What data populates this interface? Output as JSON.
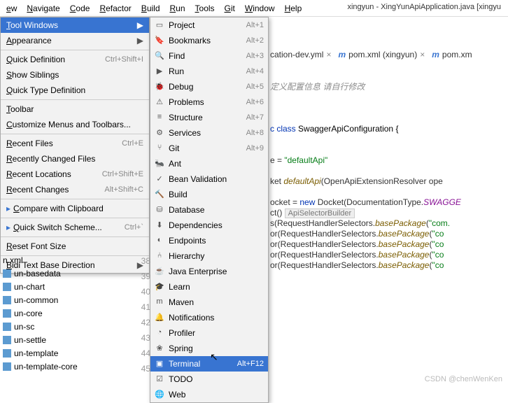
{
  "menubar": [
    "ew",
    "Navigate",
    "Code",
    "Refactor",
    "Build",
    "Run",
    "Tools",
    "Git",
    "Window",
    "Help"
  ],
  "title": "xingyun - XingYunApiApplication.java [xingyu",
  "dropdown1": [
    {
      "label": "Tool Windows",
      "sub": true,
      "sel": true
    },
    {
      "label": "Appearance",
      "sub": true
    },
    {
      "sep": true
    },
    {
      "label": "Quick Definition",
      "short": "Ctrl+Shift+I"
    },
    {
      "label": "Show Siblings"
    },
    {
      "label": "Quick Type Definition"
    },
    {
      "sep": true
    },
    {
      "label": "Toolbar"
    },
    {
      "label": "Customize Menus and Toolbars..."
    },
    {
      "sep": true
    },
    {
      "label": "Recent Files",
      "short": "Ctrl+E"
    },
    {
      "label": "Recently Changed Files"
    },
    {
      "label": "Recent Locations",
      "short": "Ctrl+Shift+E"
    },
    {
      "label": "Recent Changes",
      "short": "Alt+Shift+C"
    },
    {
      "sep": true
    },
    {
      "label": "Compare with Clipboard",
      "bullet": true
    },
    {
      "sep": true
    },
    {
      "label": "Quick Switch Scheme...",
      "short": "Ctrl+`",
      "bullet": true
    },
    {
      "sep": true
    },
    {
      "label": "Reset Font Size"
    },
    {
      "sep": true
    },
    {
      "label": "Bidi Text Base Direction",
      "sub": true
    }
  ],
  "dropdown2": [
    {
      "ico": "▭",
      "label": "Project",
      "short": "Alt+1"
    },
    {
      "ico": "🔖",
      "label": "Bookmarks",
      "short": "Alt+2"
    },
    {
      "ico": "🔍",
      "label": "Find",
      "short": "Alt+3"
    },
    {
      "ico": "▶",
      "label": "Run",
      "short": "Alt+4"
    },
    {
      "ico": "🐞",
      "label": "Debug",
      "short": "Alt+5"
    },
    {
      "ico": "⚠",
      "label": "Problems",
      "short": "Alt+6"
    },
    {
      "ico": "≡",
      "label": "Structure",
      "short": "Alt+7"
    },
    {
      "ico": "⚙",
      "label": "Services",
      "short": "Alt+8"
    },
    {
      "ico": "⑂",
      "label": "Git",
      "short": "Alt+9"
    },
    {
      "ico": "🐜",
      "label": "Ant"
    },
    {
      "ico": "✓",
      "label": "Bean Validation"
    },
    {
      "ico": "🔨",
      "label": "Build"
    },
    {
      "ico": "⛁",
      "label": "Database"
    },
    {
      "ico": "⬇",
      "label": "Dependencies"
    },
    {
      "ico": "◐",
      "label": "Endpoints"
    },
    {
      "ico": "⑃",
      "label": "Hierarchy"
    },
    {
      "ico": "☕",
      "label": "Java Enterprise"
    },
    {
      "ico": "🎓",
      "label": "Learn"
    },
    {
      "ico": "m",
      "label": "Maven"
    },
    {
      "ico": "🔔",
      "label": "Notifications"
    },
    {
      "ico": "◔",
      "label": "Profiler"
    },
    {
      "ico": "❀",
      "label": "Spring"
    },
    {
      "ico": "▣",
      "label": "Terminal",
      "short": "Alt+F12",
      "sel": true
    },
    {
      "ico": "☑",
      "label": "TODO"
    },
    {
      "ico": "🌐",
      "label": "Web"
    }
  ],
  "tabs": [
    {
      "icon": "",
      "label": "cation-dev.yml",
      "close": "×"
    },
    {
      "icon": "m",
      "label": "pom.xml (xingyun)",
      "close": "×"
    },
    {
      "icon": "m",
      "label": "pom.xm"
    }
  ],
  "gutter": [
    "38",
    "39",
    "40",
    "41",
    "42",
    "43",
    "44",
    "45"
  ],
  "proj": [
    "n.xml",
    "un-basedata",
    "un-chart",
    "un-common",
    "un-core",
    "un-sc",
    "un-settle",
    "un-template",
    "un-template-core"
  ],
  "code": {
    "comment": "定义配置信息 请自行修改",
    "l1a": "c ",
    "l1b": "class",
    "l1c": " SwaggerApiConfiguration {",
    "l2a": "e = ",
    "l2b": "\"defaultApi\"",
    "l3a": "ket ",
    "l3b": "defaultApi",
    "l3c": "(OpenApiExtensionResolver ope",
    "l4a": "ocket",
    "l4b": " = ",
    "l4c": "new",
    "l4d": " Docket(DocumentationType.",
    "l4e": "SWAGGE",
    "l5a": "ct() ",
    "l5hint": "ApiSelectorBuilder",
    "l6a": "s(RequestHandlerSelectors.",
    "l6b": "basePackage",
    "l6c": "(",
    "l6d": "\"com.",
    "l7a": "or(RequestHandlerSelectors.",
    "l7b": "basePackage",
    "l7c": "(",
    "l7d": "\"co",
    "l8a": "or(RequestHandlerSelectors.",
    "l8b": "basePackage",
    "l8c": "(",
    "l8d": "\"co",
    "l9a": "or(RequestHandlerSelectors.",
    "l9b": "basePackage",
    "l9c": "(",
    "l9d": "\"co",
    "l10a": "or(RequestHandlerSelectors.",
    "l10b": "basePackage",
    "l10c": "(",
    "l10d": "\"co"
  },
  "watermark": "CSDN @chenWenKen"
}
